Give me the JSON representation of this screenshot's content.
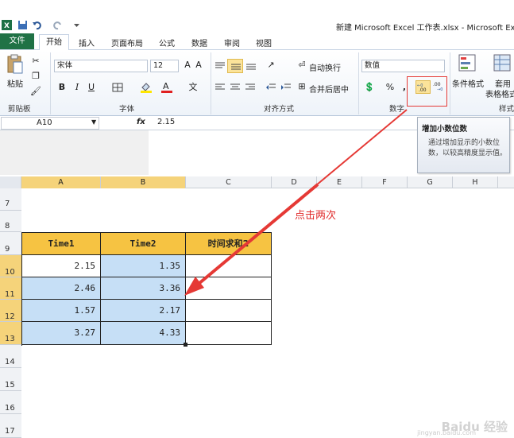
{
  "window": {
    "title": "新建 Microsoft Excel 工作表.xlsx - Microsoft Exce"
  },
  "tabs": [
    "文件",
    "开始",
    "插入",
    "页面布局",
    "公式",
    "数据",
    "审阅",
    "视图"
  ],
  "ribbon": {
    "clipboard": {
      "paste_label": "粘贴",
      "group_label": "剪贴板"
    },
    "font": {
      "font_name": "宋体",
      "font_size": "12",
      "group_label": "字体",
      "bold": "B",
      "italic": "I",
      "underline": "U"
    },
    "alignment": {
      "wrap_text": "自动换行",
      "merge_center": "合并后居中",
      "group_label": "对齐方式"
    },
    "number": {
      "format": "数值",
      "percent": "%",
      "comma": ",",
      "group_label": "数字"
    },
    "styles": {
      "conditional": "条件格式",
      "table_line1": "套用",
      "table_line2": "表格格式",
      "group_label": "样式"
    }
  },
  "formula_bar": {
    "name_box": "A10",
    "fx": "fx",
    "value": "2.15"
  },
  "tooltip": {
    "title": "增加小数位数",
    "description": "通过增加显示的小数位数，以较高精度显示值。"
  },
  "columns": [
    "A",
    "B",
    "C",
    "D",
    "E",
    "F",
    "G",
    "H"
  ],
  "rows": [
    "7",
    "8",
    "9",
    "10",
    "11",
    "12",
    "13",
    "14",
    "15",
    "16",
    "17"
  ],
  "table": {
    "headers": [
      "Time1",
      "Time2",
      "时间求和2"
    ],
    "rows": [
      [
        "2.15",
        "1.35",
        ""
      ],
      [
        "2.46",
        "3.36",
        ""
      ],
      [
        "1.57",
        "2.17",
        ""
      ],
      [
        "3.27",
        "4.33",
        ""
      ]
    ]
  },
  "annotation": "点击两次",
  "watermark": {
    "text": "Baidu 经验",
    "sub": "jingyan.baidu.com"
  },
  "colors": {
    "accent_file_tab": "#207245",
    "header_fill": "#f6c342",
    "selection_fill": "#c6dff6",
    "annotation": "#e02a2a"
  }
}
